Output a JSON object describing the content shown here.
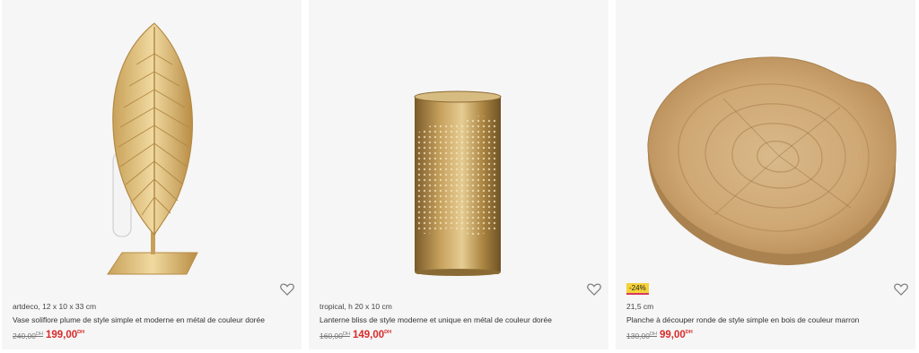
{
  "products": [
    {
      "subtitle": "artdeco, 12 x 10 x 33 cm",
      "title": "Vase soliflore plume de style simple et moderne en métal de couleur dorée",
      "old_price": "240,00",
      "old_currency": "DH",
      "new_price": "199,00",
      "new_currency": "DH",
      "image_icon": "leaf-vase-image",
      "badge": ""
    },
    {
      "subtitle": "tropical, h 20 x 10 cm",
      "title": "Lanterne bliss de style moderne et unique en métal de couleur dorée",
      "old_price": "160,00",
      "old_currency": "DH",
      "new_price": "149,00",
      "new_currency": "DH",
      "image_icon": "lantern-image",
      "badge": ""
    },
    {
      "subtitle": "21,5 cm",
      "title": "Planche à découper ronde de style simple en bois de couleur marron",
      "old_price": "130,00",
      "old_currency": "DH",
      "new_price": "99,00",
      "new_currency": "DH",
      "image_icon": "wood-board-image",
      "badge": "-24%"
    }
  ],
  "colors": {
    "sale_price": "#d92a2a",
    "badge_bg": "#f5d23a",
    "card_bg": "#f6f6f6"
  },
  "icons": {
    "favorite": "heart-icon"
  }
}
